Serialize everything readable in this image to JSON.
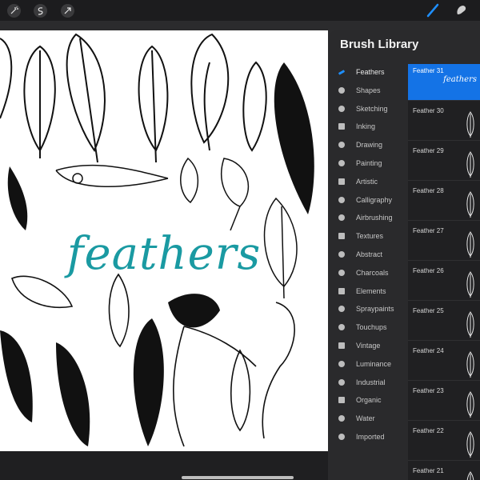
{
  "toolbar": {
    "left_tools": [
      "magic-wand-icon",
      "selection-icon",
      "transform-icon"
    ],
    "right_tools": [
      "brush-icon",
      "smudge-icon"
    ]
  },
  "canvas": {
    "title": "feathers",
    "accent": "#1a9aa2"
  },
  "brush_library": {
    "title": "Brush Library",
    "categories": [
      "Feathers",
      "Shapes",
      "Sketching",
      "Inking",
      "Drawing",
      "Painting",
      "Artistic",
      "Calligraphy",
      "Airbrushing",
      "Textures",
      "Abstract",
      "Charcoals",
      "Elements",
      "Spraypaints",
      "Touchups",
      "Vintage",
      "Luminance",
      "Industrial",
      "Organic",
      "Water",
      "Imported"
    ],
    "active_category": "Feathers",
    "brushes": [
      "Feather 31",
      "Feather 30",
      "Feather 29",
      "Feather 28",
      "Feather 27",
      "Feather 26",
      "Feather 25",
      "Feather 24",
      "Feather 23",
      "Feather 22",
      "Feather 21"
    ],
    "selected_brush": "Feather 31",
    "selected_preview": "feathers",
    "selected_color": "#1473e6"
  }
}
